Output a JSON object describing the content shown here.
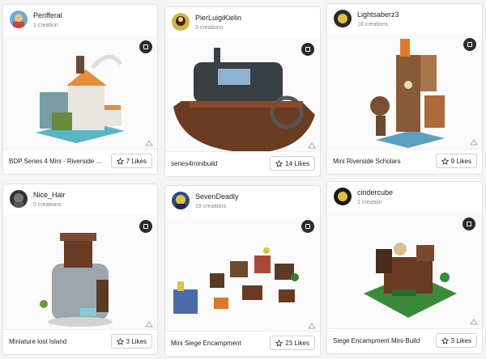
{
  "cards": [
    {
      "user": "Perifferal",
      "creations": "1 creation",
      "title": "BDP Series 4 Mini - Riverside S…",
      "likes": "7 Likes"
    },
    {
      "user": "PierLuigiKielin",
      "creations": "3 creations",
      "title": "series4minibuild",
      "likes": "14 Likes"
    },
    {
      "user": "Lightsaberz3",
      "creations": "18 creations",
      "title": "Mini Riverside Scholars",
      "likes": "9 Likes"
    },
    {
      "user": "Nice_Hair",
      "creations": "5 creations",
      "title": "Miniature lost Island",
      "likes": "3 Likes"
    },
    {
      "user": "SevenDeadly",
      "creations": "19 creations",
      "title": "Mini Siege Encampment",
      "likes": "23 Likes"
    },
    {
      "user": "cindercube",
      "creations": "1 creation",
      "title": "Siege Encampment Mini-Build",
      "likes": "3 Likes"
    }
  ],
  "icons": {
    "badge": "model-badge-icon",
    "render": "render-hint-icon",
    "star": "star-icon",
    "avatar": "user-avatar"
  }
}
